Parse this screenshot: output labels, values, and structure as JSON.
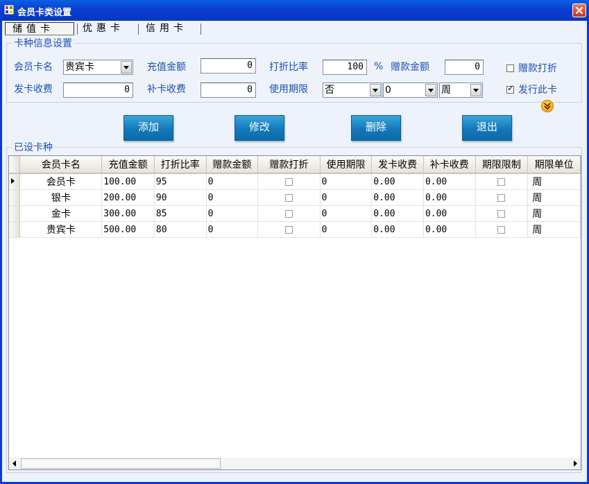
{
  "window": {
    "title": "会员卡类设置"
  },
  "tabs": [
    {
      "label": "储值卡",
      "active": true
    },
    {
      "label": "优惠卡",
      "active": false
    },
    {
      "label": "信用卡",
      "active": false
    }
  ],
  "info_group": {
    "legend": "卡种信息设置",
    "card_name_label": "会员卡名",
    "card_name_value": "贵宾卡",
    "recharge_label": "充值金额",
    "recharge_value": "0",
    "discount_label": "打折比率",
    "discount_value": "100",
    "percent": "%",
    "gift_label": "赠款金额",
    "gift_value": "0",
    "gift_discount_label": "赠款打折",
    "gift_discount_checked": false,
    "issue_fee_label": "发卡收费",
    "issue_fee_value": "0",
    "replace_fee_label": "补卡收费",
    "replace_fee_value": "0",
    "validity_label": "使用期限",
    "validity_enabled_value": "否",
    "validity_amount_value": "0",
    "validity_unit_value": "周",
    "issue_card_label": "发行此卡",
    "issue_card_checked": true
  },
  "buttons": {
    "add": "添加",
    "modify": "修改",
    "delete": "删除",
    "exit": "退出"
  },
  "list_group": {
    "legend": "已设卡种",
    "columns": [
      "会员卡名",
      "充值金额",
      "打折比率",
      "赠款金额",
      "赠款打折",
      "使用期限",
      "发卡收费",
      "补卡收费",
      "期限限制",
      "期限单位"
    ],
    "rows": [
      {
        "name": "会员卡",
        "recharge": "100.00",
        "discount": "95",
        "gift": "0",
        "validity": "0",
        "issue_fee": "0.00",
        "replace_fee": "0.00",
        "unit": "周"
      },
      {
        "name": "银卡",
        "recharge": "200.00",
        "discount": "90",
        "gift": "0",
        "validity": "0",
        "issue_fee": "0.00",
        "replace_fee": "0.00",
        "unit": "周"
      },
      {
        "name": "金卡",
        "recharge": "300.00",
        "discount": "85",
        "gift": "0",
        "validity": "0",
        "issue_fee": "0.00",
        "replace_fee": "0.00",
        "unit": "周"
      },
      {
        "name": "贵宾卡",
        "recharge": "500.00",
        "discount": "80",
        "gift": "0",
        "validity": "0",
        "issue_fee": "0.00",
        "replace_fee": "0.00",
        "unit": "周"
      }
    ]
  },
  "icons": {
    "app": "app-icon",
    "close": "close-icon",
    "expand": "expand-chevron-icon",
    "row_pointer": "row-pointer-icon"
  },
  "colors": {
    "title_bar": "#0a3fcf",
    "label_blue": "#1c4fb0",
    "button_blue": "#1278bb"
  }
}
